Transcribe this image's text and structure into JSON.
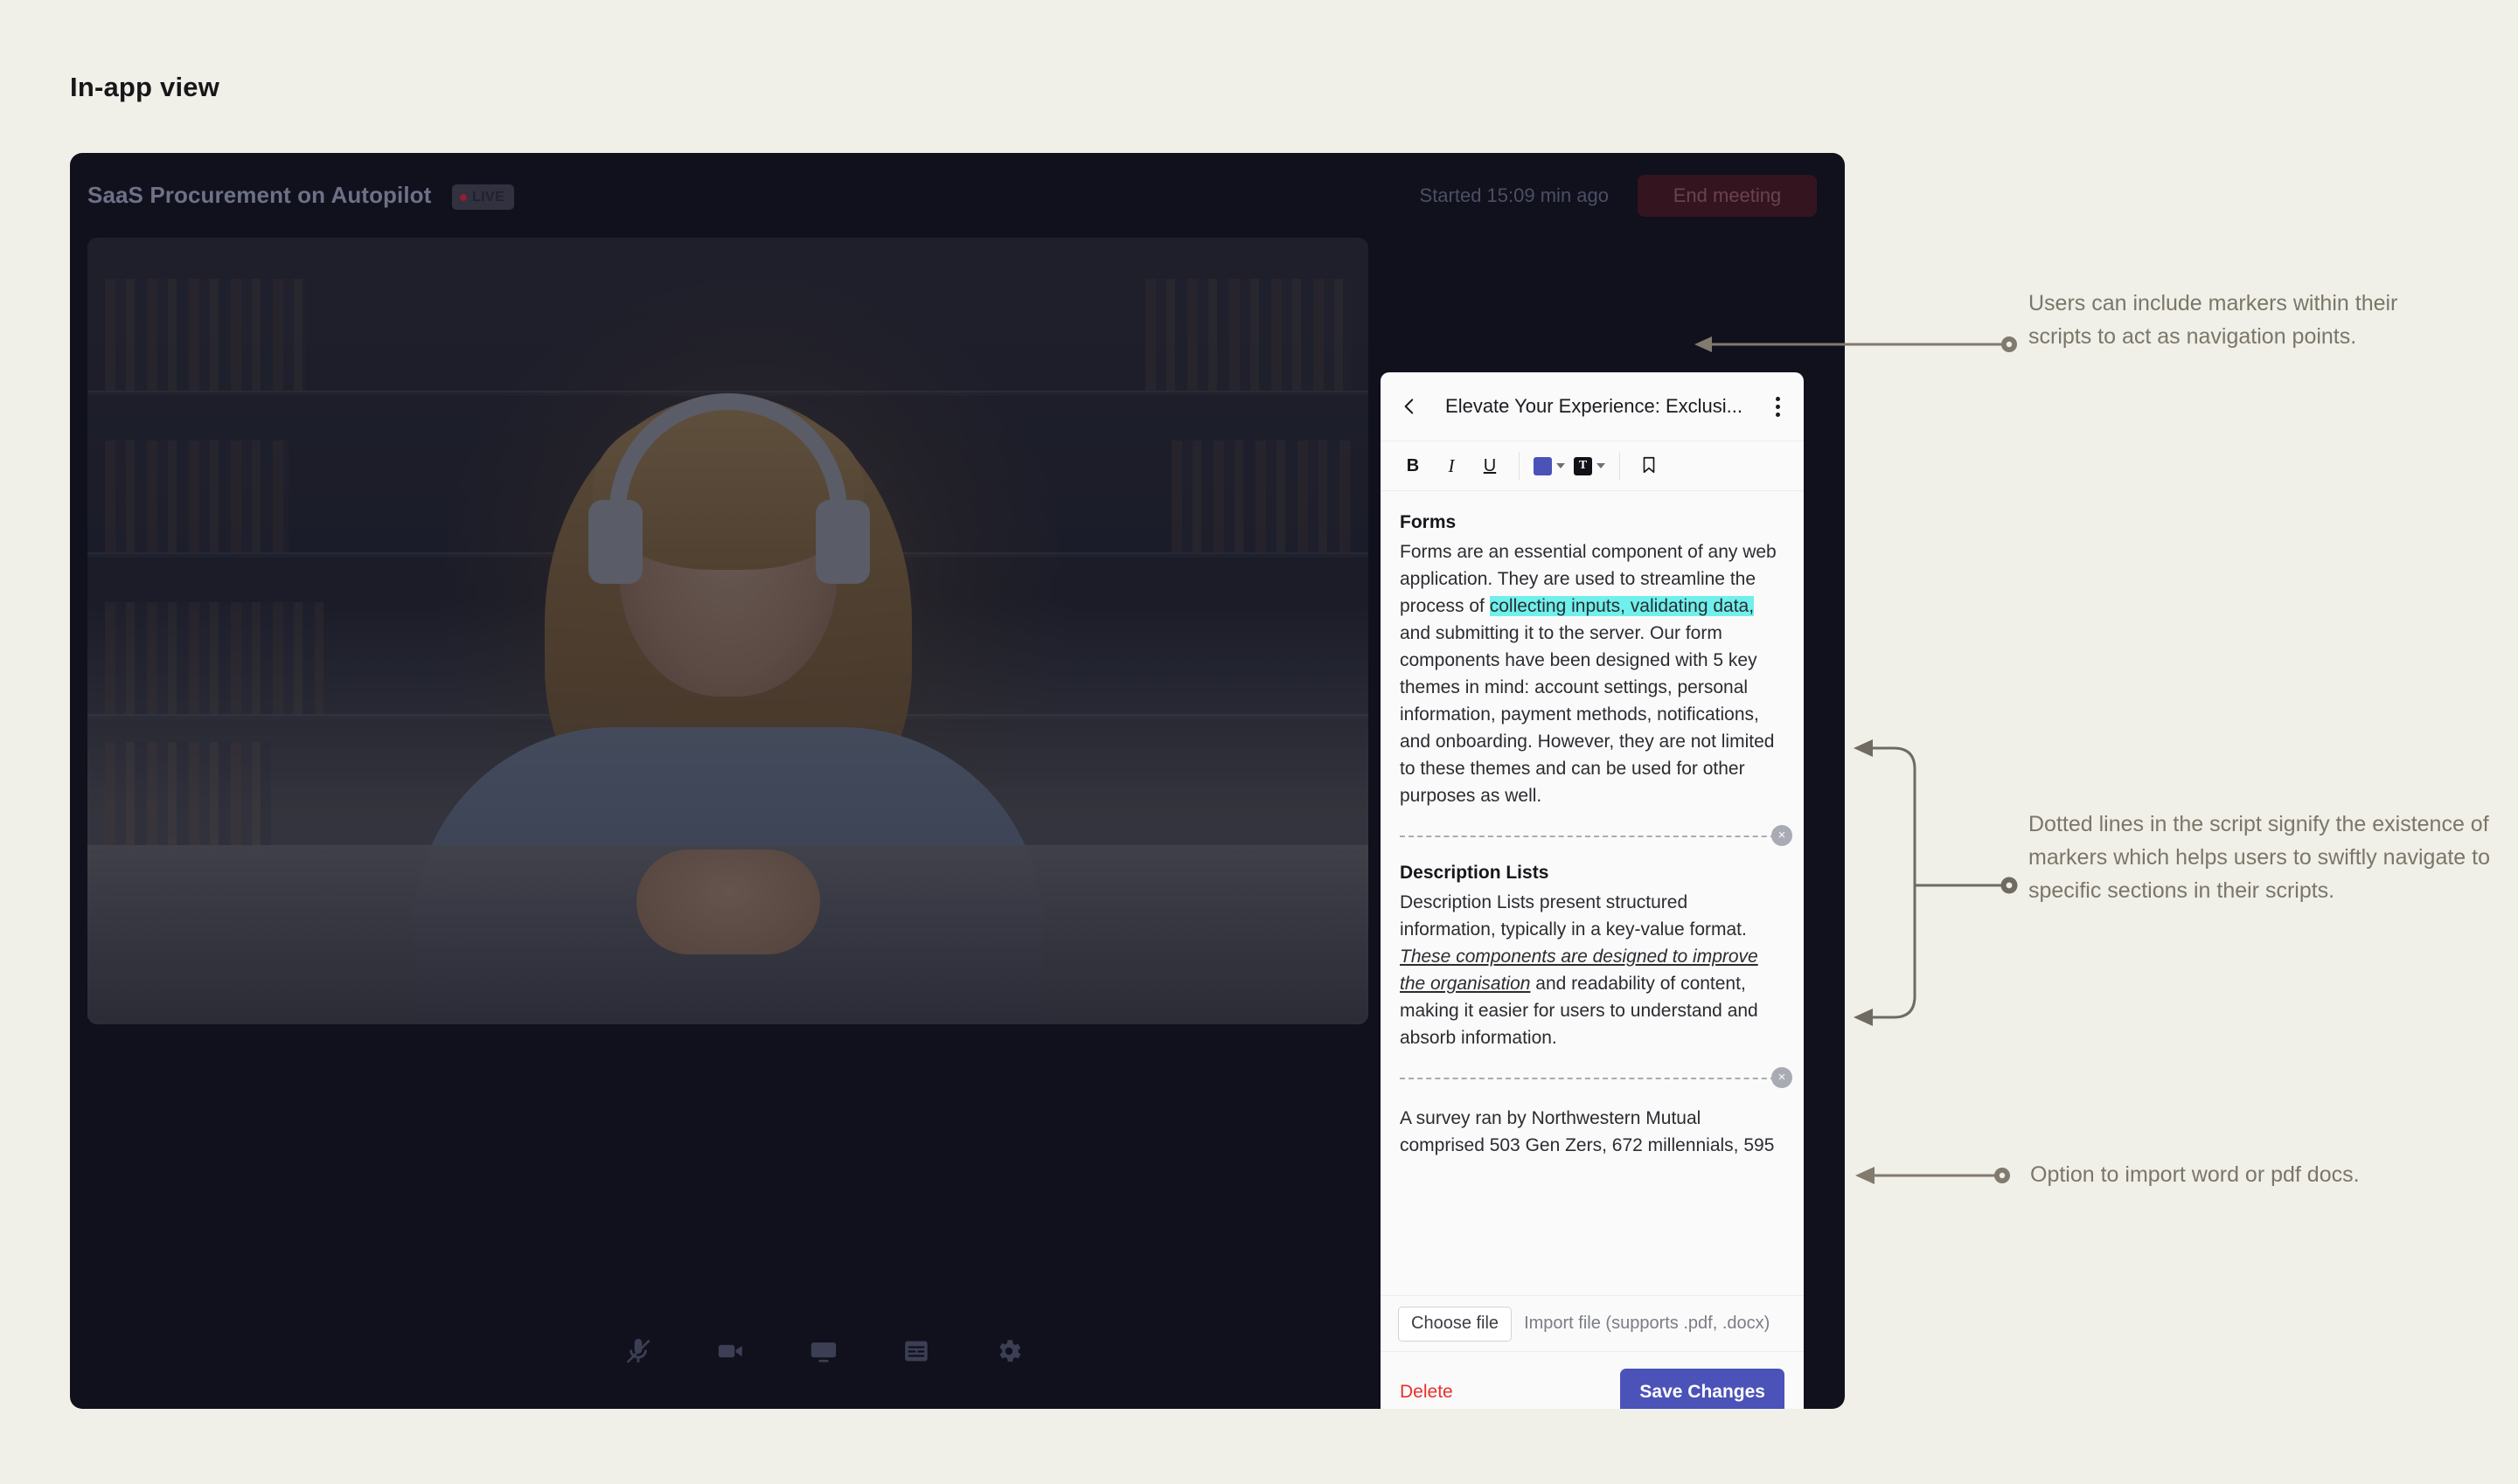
{
  "page": {
    "title": "In-app view"
  },
  "meeting": {
    "title": "SaaS Procurement on Autopilot",
    "live_label": "LIVE",
    "started_label": "Started 15:09 min ago",
    "end_meeting_label": "End meeting"
  },
  "script_panel": {
    "title": "Elevate Your Experience: Exclusi...",
    "back_icon": "chevron-left-icon",
    "more_icon": "kebab-menu-icon",
    "toolbar": {
      "bold_label": "B",
      "italic_label": "I",
      "underline_label": "U",
      "highlight_color": "#4b52b8",
      "text_color_label": "T",
      "bookmark_icon": "bookmark-icon"
    },
    "sections": [
      {
        "heading": "Forms",
        "before_highlight": "Forms are an essential component of any web application. They are used to streamline the process of ",
        "highlight": "collecting inputs, validating data,",
        "after_highlight": " and submitting it to the server. Our form components have been designed with 5 key themes in mind: account settings, personal information, payment methods, notifications, and onboarding. However, they are not limited to these themes and can be used for other purposes as well."
      },
      {
        "heading": "Description Lists",
        "before_emphasis": "Description Lists present structured information, typically in a key-value format. ",
        "emphasis": "These components are designed to improve the organisation",
        "after_emphasis": " and readability of content, making it easier for users to understand and absorb information."
      }
    ],
    "trailing_paragraph": "A survey ran by Northwestern Mutual comprised 503 Gen Zers, 672 millennials, 595",
    "marker_close_label": "×",
    "import": {
      "choose_file_label": "Choose file",
      "hint": "Import file (supports .pdf, .docx)"
    },
    "footer": {
      "delete_label": "Delete",
      "save_label": "Save Changes",
      "save_color": "#4b52b8",
      "delete_color": "#e8302c"
    }
  },
  "controls": {
    "left": [
      {
        "name": "microphone-muted-icon"
      },
      {
        "name": "camera-icon"
      },
      {
        "name": "screen-share-icon"
      },
      {
        "name": "captions-icon"
      },
      {
        "name": "settings-gear-icon"
      }
    ],
    "right": [
      {
        "name": "participants-icon",
        "active": true
      },
      {
        "name": "chat-icon",
        "active": false
      },
      {
        "name": "analytics-icon",
        "active": false
      },
      {
        "name": "script-clipboard-icon",
        "active": true
      }
    ]
  },
  "annotations": [
    {
      "text": "Users can include markers within their scripts to act as navigation points."
    },
    {
      "text": "Dotted lines in the script signify the existence of markers which helps users to swiftly navigate to specific sections in their scripts."
    },
    {
      "text": "Option to import word or pdf docs."
    }
  ],
  "colors": {
    "background": "#f0efe8",
    "window": "#10111d",
    "panel": "#fafafa",
    "highlight": "#6ff0ec",
    "annotation_text": "#7b7668"
  }
}
